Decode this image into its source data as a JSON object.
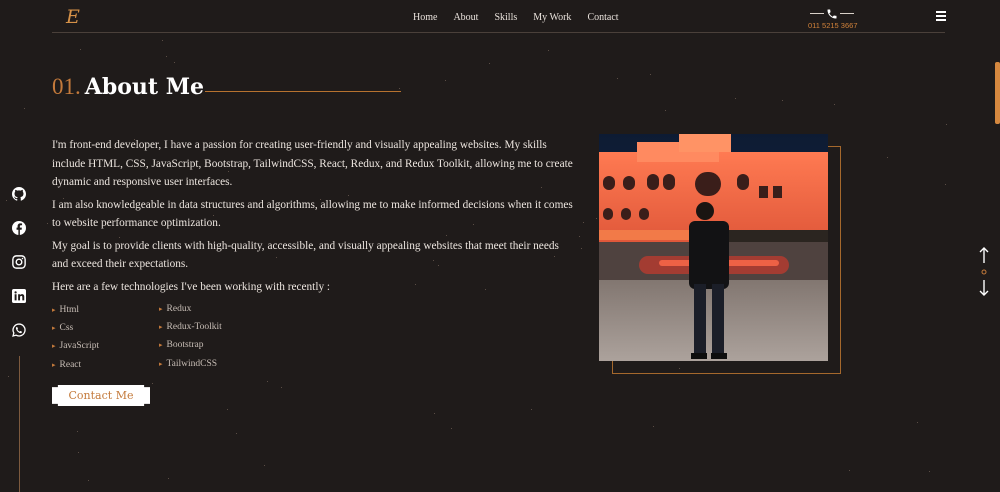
{
  "header": {
    "logo_alt": "E",
    "nav": [
      "Home",
      "About",
      "Skills",
      "My Work",
      "Contact"
    ],
    "phone": "011 5215 3667"
  },
  "section": {
    "number": "01.",
    "title": "About Me"
  },
  "about": {
    "p1": "I'm front-end developer, I have a passion for creating user-friendly and visually appealing websites. My skills include HTML, CSS, JavaScript, Bootstrap, TailwindCSS, React, Redux, and Redux Toolkit, allowing me to create dynamic and responsive user interfaces.",
    "p2": "I am also knowledgeable in data structures and algorithms, allowing me to make informed decisions when it comes to website performance optimization.",
    "p3": "My goal is to provide clients with high-quality, accessible, and visually appealing websites that meet their needs and exceed their expectations.",
    "p4": "Here are a few technologies I've been working with recently :"
  },
  "technologies": {
    "col1": [
      "Html",
      "Css",
      "JavaScript",
      "React"
    ],
    "col2": [
      "Redux",
      "Redux-Toolkit",
      "Bootstrap",
      "TailwindCSS"
    ]
  },
  "contact_button": "Contact Me",
  "social": [
    "github-icon",
    "facebook-icon",
    "instagram-icon",
    "linkedin-icon",
    "whatsapp-icon"
  ],
  "colors": {
    "accent": "#c47a3b",
    "background": "#1f1b1a",
    "text": "#ece5df"
  }
}
